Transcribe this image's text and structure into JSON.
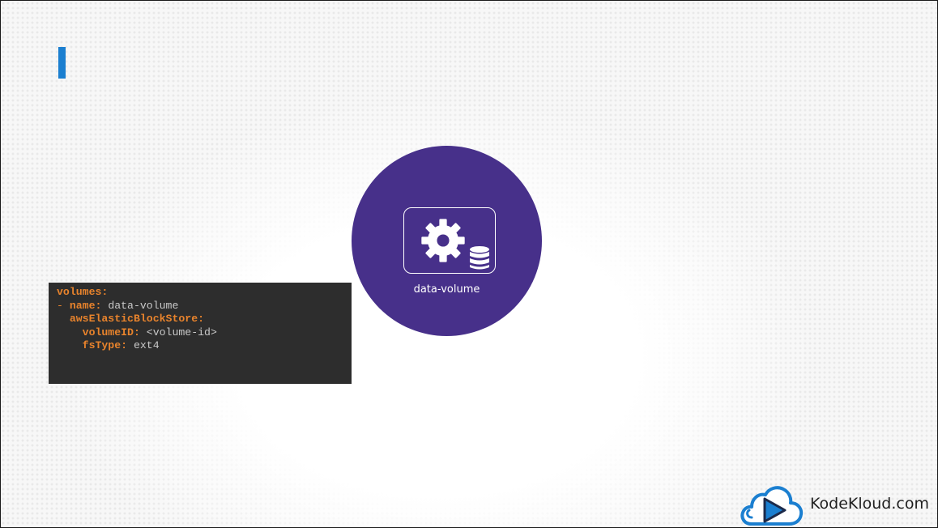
{
  "slide": {
    "accent_color": "#1b7fd0",
    "circle_color": "#47308a"
  },
  "code": {
    "lines": [
      {
        "dash": "",
        "key": "volumes:",
        "value": ""
      },
      {
        "dash": "- ",
        "key": "name:",
        "value": " data-volume"
      },
      {
        "dash": "  ",
        "key": "awsElasticBlockStore:",
        "value": ""
      },
      {
        "dash": "    ",
        "key": "volumeID:",
        "value": " <volume-id>"
      },
      {
        "dash": "    ",
        "key": "fsType:",
        "value": " ext4"
      }
    ]
  },
  "volume": {
    "label": "data-volume",
    "icon": "gear-icon",
    "storage_icon": "database-icon"
  },
  "brand": {
    "name": "KodeKloud.com",
    "icon": "cloud-play-icon",
    "colors": {
      "cloud": "#1b7fd0",
      "play": "#1c2a4a"
    }
  }
}
